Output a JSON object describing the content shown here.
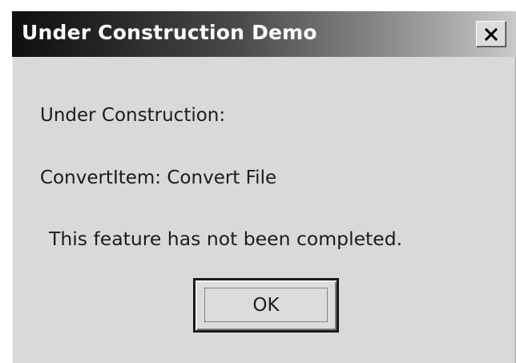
{
  "window": {
    "title": "Under Construction Demo"
  },
  "message": {
    "heading": "Under Construction:",
    "item_prefix": "ConvertItem: ",
    "item_name": "Convert File",
    "detail": "This feature has not been completed."
  },
  "buttons": {
    "ok_label": "OK",
    "close_icon": "close-icon"
  },
  "colors": {
    "dialog_bg": "#d9d9d9",
    "title_dark": "#0f0f0f",
    "title_light": "#c9c9c9",
    "text": "#1c1c1c"
  }
}
